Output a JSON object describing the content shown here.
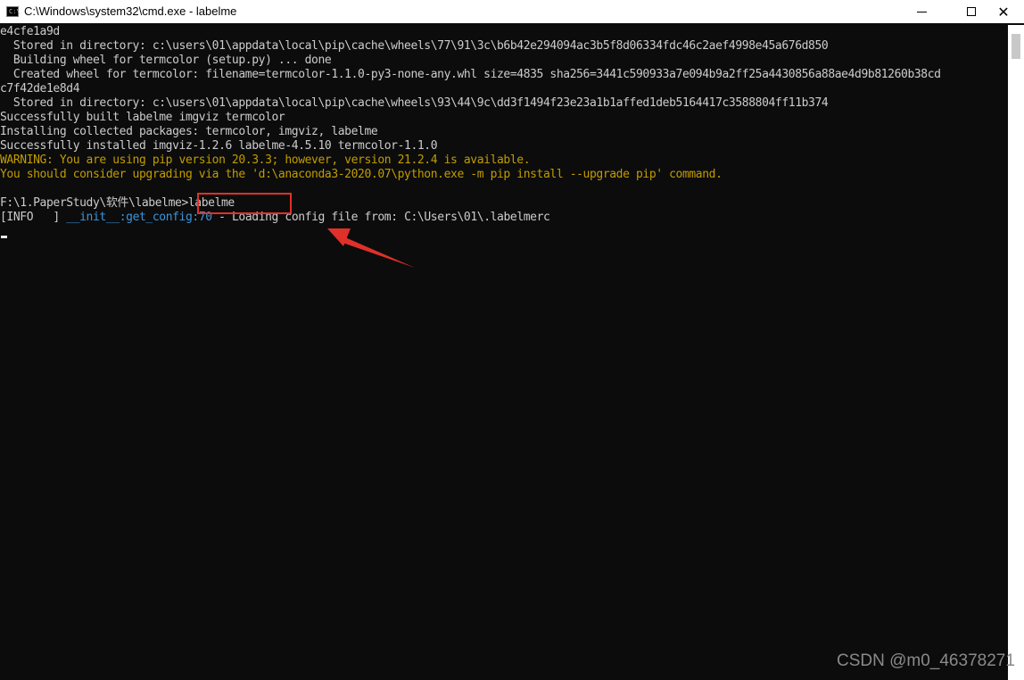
{
  "window": {
    "title": "C:\\Windows\\system32\\cmd.exe - labelme",
    "icon": "cmd-icon",
    "icon_text": "C:\\",
    "minimize_icon": "minimize-icon",
    "maximize_icon": "maximize-icon",
    "close_icon": "close-icon",
    "close_glyph": "✕"
  },
  "console": {
    "lines": [
      "e4cfe1a9d",
      "  Stored in directory: c:\\users\\01\\appdata\\local\\pip\\cache\\wheels\\77\\91\\3c\\b6b42e294094ac3b5f8d06334fdc46c2aef4998e45a676d850",
      "  Building wheel for termcolor (setup.py) ... done",
      "  Created wheel for termcolor: filename=termcolor-1.1.0-py3-none-any.whl size=4835 sha256=3441c590933a7e094b9a2ff25a4430856a88ae4d9b81260b38cd",
      "c7f42de1e8d4",
      "  Stored in directory: c:\\users\\01\\appdata\\local\\pip\\cache\\wheels\\93\\44\\9c\\dd3f1494f23e23a1b1affed1deb5164417c3588804ff11b374",
      "Successfully built labelme imgviz termcolor",
      "Installing collected packages: termcolor, imgviz, labelme",
      "Successfully installed imgviz-1.2.6 labelme-4.5.10 termcolor-1.1.0"
    ],
    "warning_lines": [
      "WARNING: You are using pip version 20.3.3; however, version 21.2.4 is available.",
      "You should consider upgrading via the 'd:\\anaconda3-2020.07\\python.exe -m pip install --upgrade pip' command."
    ],
    "prompt": "F:\\1.PaperStudy\\软件\\labelme>",
    "command": "labelme",
    "info_prefix": "[INFO   ] ",
    "info_location": "__init__",
    "info_sep": ":",
    "info_func": "get_config",
    "info_line": ":70",
    "info_message": " - Loading config file from: C:\\Users\\01\\.labelmerc"
  },
  "colors": {
    "background": "#0c0c0c",
    "text": "#cccccc",
    "warning": "#c19c00",
    "info_link": "#3a96dd",
    "annotation": "#e0302a"
  },
  "watermark": "CSDN @m0_46378271"
}
